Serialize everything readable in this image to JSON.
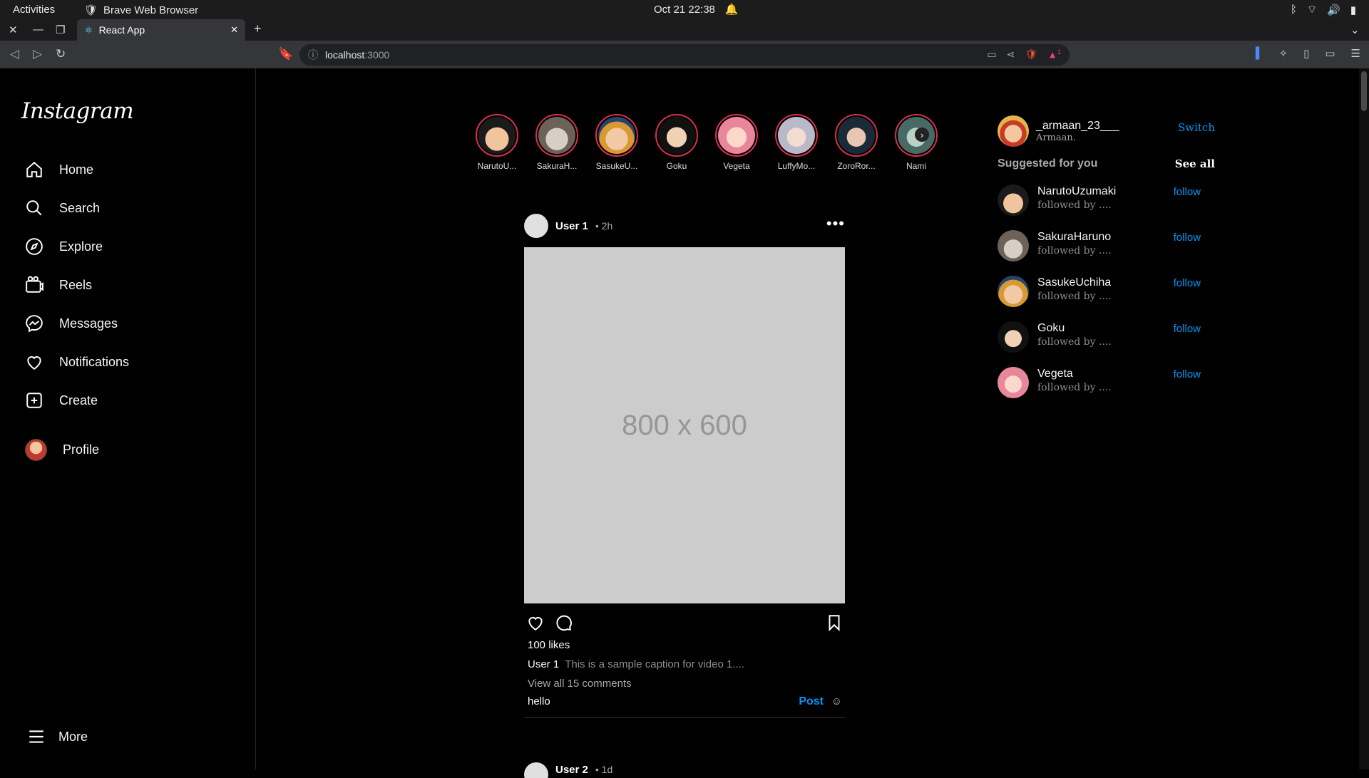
{
  "os": {
    "activities": "Activities",
    "app_name": "Brave Web Browser",
    "clock": "Oct 21  22:38"
  },
  "browser": {
    "tab_title": "React App",
    "url_host": "localhost",
    "url_port": ":3000",
    "shield_badge": "1"
  },
  "sidebar": {
    "logo": "Instagram",
    "items": [
      {
        "label": "Home",
        "icon": "home-icon"
      },
      {
        "label": "Search",
        "icon": "search-icon"
      },
      {
        "label": "Explore",
        "icon": "compass-icon"
      },
      {
        "label": "Reels",
        "icon": "reels-icon"
      },
      {
        "label": "Messages",
        "icon": "messenger-icon"
      },
      {
        "label": "Notifications",
        "icon": "heart-icon"
      },
      {
        "label": "Create",
        "icon": "plus-square-icon"
      },
      {
        "label": "Profile",
        "icon": "avatar"
      }
    ],
    "more": "More"
  },
  "stories": [
    {
      "name": "NarutoU..."
    },
    {
      "name": "SakuraH..."
    },
    {
      "name": "SasukeU..."
    },
    {
      "name": "Goku"
    },
    {
      "name": "Vegeta"
    },
    {
      "name": "LuffyMo..."
    },
    {
      "name": "ZoroRor..."
    },
    {
      "name": "Nami"
    }
  ],
  "post": {
    "user": "User 1",
    "time": "• 2h",
    "image_text": "800 x 600",
    "likes": "100 likes",
    "caption_user": "User 1",
    "caption_text": "This is a sample caption for video 1....",
    "view_comments": "View all 15 comments",
    "comment_value": "hello",
    "post_label": "Post"
  },
  "post2": {
    "user": "User 2",
    "time": "• 1d"
  },
  "right": {
    "username": "_armaan_23___",
    "fullname": "Armaan.",
    "switch_label": "Switch",
    "suggested_title": "Suggested for you",
    "see_all": "See all",
    "suggestions": [
      {
        "user": "NarutoUzumaki",
        "sub": "followed by ....",
        "action": "follow"
      },
      {
        "user": "SakuraHaruno",
        "sub": "followed by ....",
        "action": "follow"
      },
      {
        "user": "SasukeUchiha",
        "sub": "followed by ....",
        "action": "follow"
      },
      {
        "user": "Goku",
        "sub": "followed by ....",
        "action": "follow"
      },
      {
        "user": "Vegeta",
        "sub": "followed by ....",
        "action": "follow"
      }
    ]
  },
  "colors": {
    "accent": "#0095f6",
    "story_ring": "#d9304b",
    "background": "#000000"
  }
}
